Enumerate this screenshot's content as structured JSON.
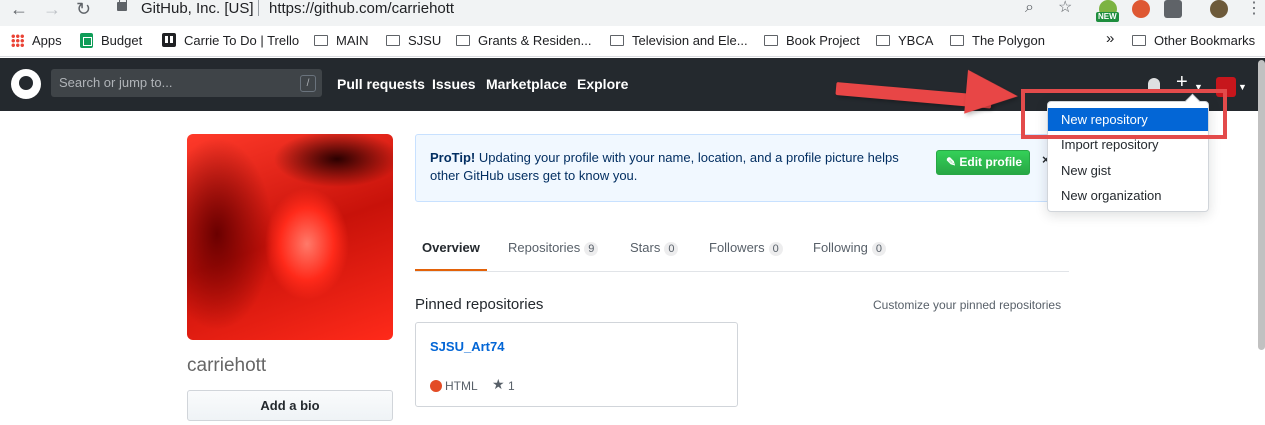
{
  "browser": {
    "site_identity": "GitHub, Inc. [US]",
    "url": "https://github.com/carriehott",
    "new_badge": "NEW"
  },
  "bookmarks": {
    "items": [
      "Apps",
      "Budget",
      "Carrie To Do | Trello",
      "MAIN",
      "SJSU",
      "Grants & Residen...",
      "Television and Ele...",
      "Book Project",
      "YBCA",
      "The Polygon"
    ],
    "overflow": "»",
    "other": "Other Bookmarks"
  },
  "header": {
    "search_placeholder": "Search or jump to...",
    "search_hotkey": "/",
    "nav": [
      "Pull requests",
      "Issues",
      "Marketplace",
      "Explore"
    ]
  },
  "dropdown": {
    "items": [
      "New repository",
      "Import repository",
      "New gist",
      "New organization"
    ],
    "active_index": 0
  },
  "profile": {
    "username": "carriehott",
    "add_bio": "Add a bio"
  },
  "protip": {
    "title": "ProTip!",
    "text": " Updating your profile with your name, location, and a profile picture helps other GitHub users get to know you.",
    "button": "Edit profile",
    "close": "×"
  },
  "tabs": [
    {
      "label": "Overview",
      "count": null
    },
    {
      "label": "Repositories",
      "count": "9"
    },
    {
      "label": "Stars",
      "count": "0"
    },
    {
      "label": "Followers",
      "count": "0"
    },
    {
      "label": "Following",
      "count": "0"
    }
  ],
  "pinned": {
    "title": "Pinned repositories",
    "customize": "Customize your pinned repositories",
    "repos": [
      {
        "name": "SJSU_Art74",
        "language": "HTML",
        "language_color": "#e34c26",
        "stars": "1"
      }
    ]
  },
  "colors": {
    "header_bg": "#24292e",
    "link": "#0366d6",
    "annotation_red": "#e84646",
    "tab_accent": "#e36209"
  }
}
